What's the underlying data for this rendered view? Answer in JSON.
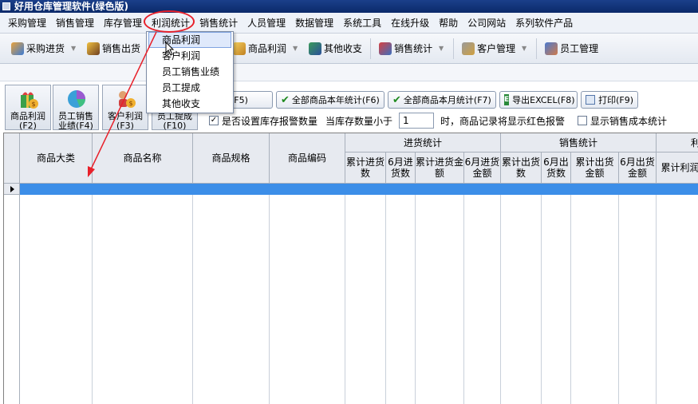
{
  "window": {
    "title": "好用仓库管理软件(绿色版)"
  },
  "menubar": {
    "items": [
      "采购管理",
      "销售管理",
      "库存管理",
      "利润统计",
      "销售统计",
      "人员管理",
      "数据管理",
      "系统工具",
      "在线升级",
      "帮助",
      "公司网站",
      "系列软件产品"
    ]
  },
  "toolbar": {
    "buttons": [
      {
        "label": "采购进货",
        "icon": "purchase-icon"
      },
      {
        "label": "销售出货",
        "icon": "sales-out-icon"
      },
      {
        "label": "商品利润",
        "icon": "profit-icon"
      },
      {
        "label": "其他收支",
        "icon": "other-income-icon"
      },
      {
        "label": "销售统计",
        "icon": "sales-stats-icon"
      },
      {
        "label": "客户管理",
        "icon": "customer-icon"
      },
      {
        "label": "员工管理",
        "icon": "employee-icon"
      }
    ]
  },
  "dropdown": {
    "items": [
      "商品利润",
      "客户利润",
      "员工销售业绩",
      "员工提成",
      "其他收支"
    ]
  },
  "big_buttons": [
    {
      "line1": "商品利润",
      "line2": "(F2)"
    },
    {
      "line1": "员工销售",
      "line2": "业绩(F4)"
    },
    {
      "line1": "客户利润",
      "line2": "(F3)"
    },
    {
      "line1": "员工提成",
      "line2": "(F10)"
    }
  ],
  "actions": {
    "query": "询(F5)",
    "year_stats": "全部商品本年统计(F6)",
    "month_stats": "全部商品本月统计(F7)",
    "export": "导出EXCEL(F8)",
    "print": "打印(F9)"
  },
  "options": {
    "stock_alarm_label": "是否设置库存报警数量",
    "stock_alarm_checked": true,
    "threshold_prefix": "当库存数量小于",
    "threshold_value": "1",
    "threshold_suffix": "时，商品记录将显示红色报警",
    "show_cost_label": "显示销售成本统计",
    "show_cost_checked": false
  },
  "grid": {
    "columns": {
      "category": "商品大类",
      "name": "商品名称",
      "spec": "商品规格",
      "code": "商品编码"
    },
    "group_purchase": "进货统计",
    "group_sales": "销售统计",
    "group_profit": "利",
    "purchase_cols": [
      "累计进货数",
      "6月进货数",
      "累计进货金额",
      "6月进货金额"
    ],
    "sales_cols": [
      "累计出货数",
      "6月出货数",
      "累计出货金额",
      "6月出货金额"
    ],
    "profit_col": "累计利润"
  }
}
